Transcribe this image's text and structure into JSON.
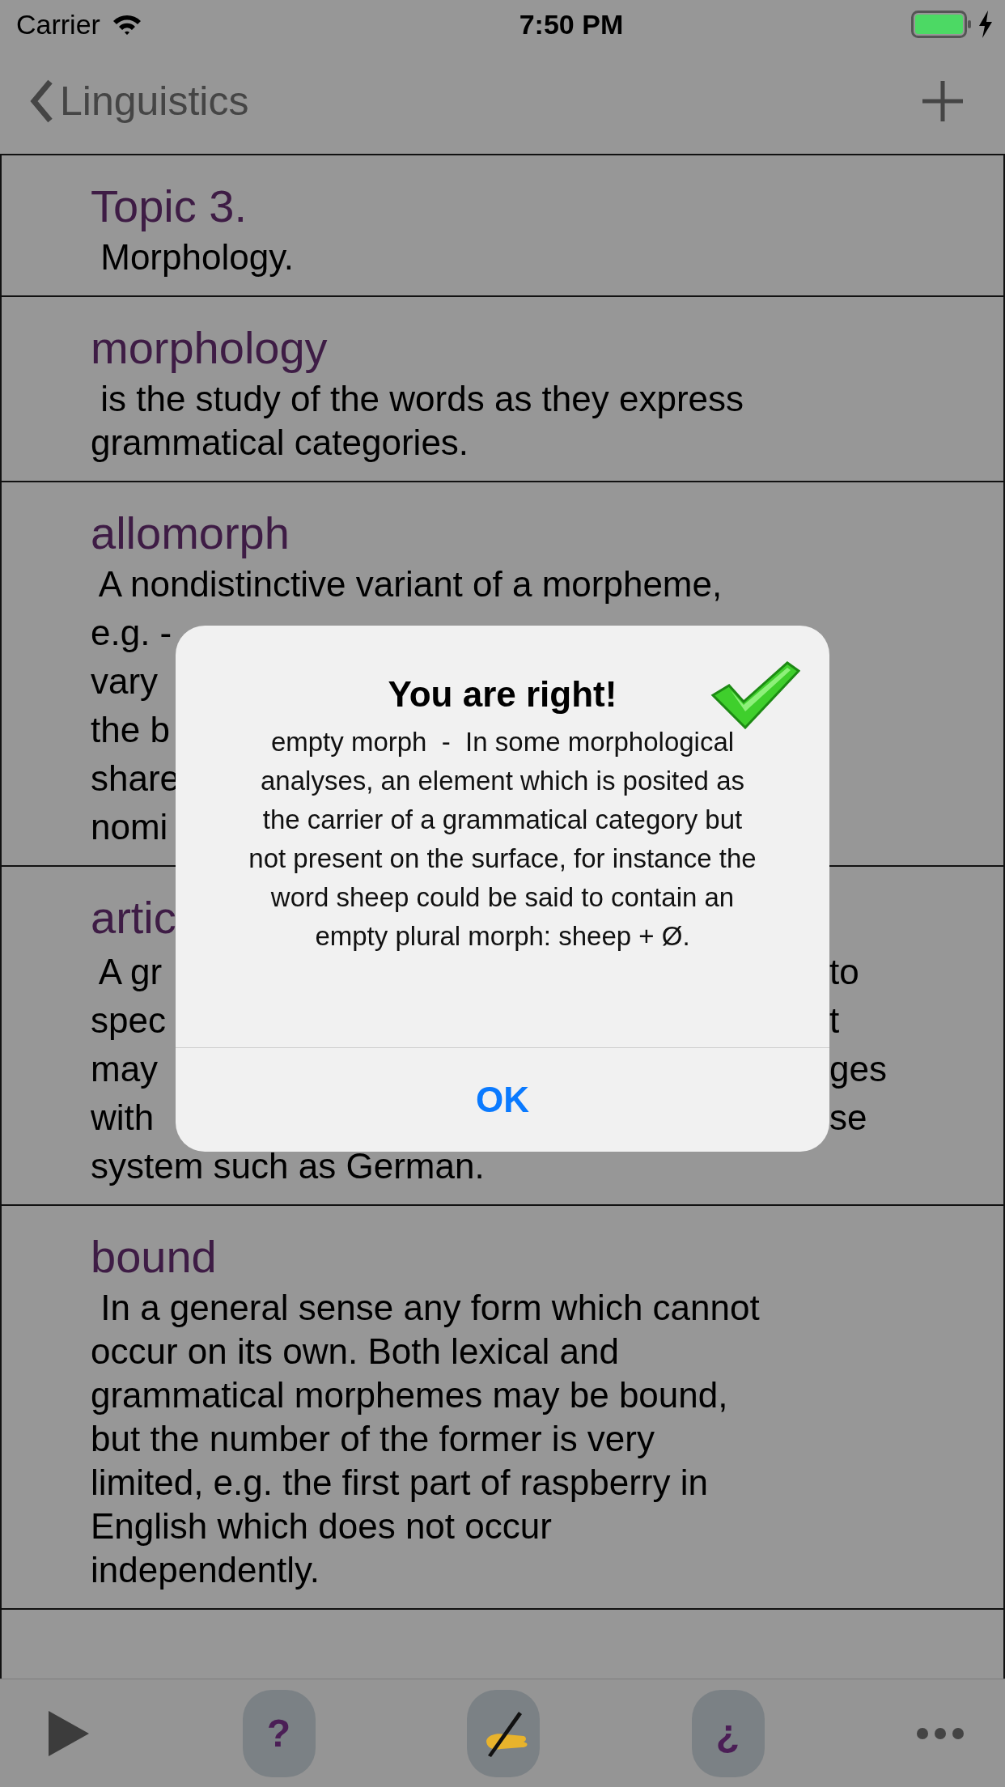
{
  "status_bar": {
    "carrier": "Carrier",
    "time": "7:50 PM"
  },
  "nav": {
    "back": "Linguistics"
  },
  "entries": [
    {
      "title": "Topic 3.",
      "lines": [
        " Morphology."
      ]
    },
    {
      "title": "morphology",
      "lines": [
        " is the study of the words as they express",
        "grammatical categories."
      ]
    },
    {
      "title": "allomorph",
      "lines": [
        " A nondistinctive variant of a morpheme,",
        {
          "left": "e.g. -"
        },
        {
          "left": "vary"
        },
        {
          "left": "the b"
        },
        {
          "left": "share"
        },
        {
          "left": "nomi"
        }
      ]
    },
    {
      "title": "artic",
      "lines": [
        {
          "left": " A gr",
          "right": "to"
        },
        {
          "left": "spec",
          "right": "t"
        },
        {
          "left": "may",
          "right": "ges"
        },
        {
          "left": "with",
          "right": "se"
        },
        "system such as German."
      ]
    },
    {
      "title": "bound",
      "lines": [
        " In a general sense any form which cannot",
        "occur on its own. Both lexical and",
        "grammatical morphemes may be bound,",
        "but the number of the former is very",
        "limited, e.g. the first part of raspberry in",
        "English which does not occur",
        "independently."
      ]
    }
  ],
  "alert": {
    "title": "You are right!",
    "message": "empty morph  -  In some morphological analyses, an element which is posited as the carrier of a grammatical category but not present on the surface, for instance the word sheep could be said to contain an empty plural morph: sheep + Ø.",
    "button": "OK"
  },
  "toolbar": {
    "question": "?",
    "inverted_question": "¿"
  }
}
